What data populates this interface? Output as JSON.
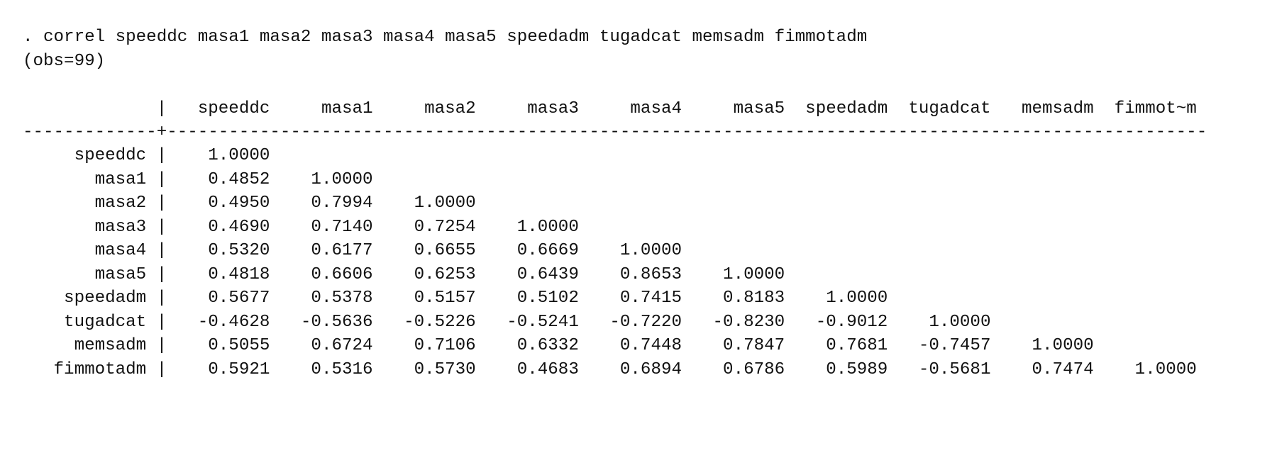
{
  "command": ". correl speeddc masa1 masa2 masa3 masa4 masa5 speedadm tugadcat memsadm fimmotadm",
  "obs_note": "(obs=99)",
  "column_headers": [
    "speeddc",
    "masa1",
    "masa2",
    "masa3",
    "masa4",
    "masa5",
    "speedadm",
    "tugadcat",
    "memsadm",
    "fimmot~m"
  ],
  "rows": [
    {
      "label": "speeddc",
      "values": [
        "1.0000"
      ]
    },
    {
      "label": "masa1",
      "values": [
        "0.4852",
        "1.0000"
      ]
    },
    {
      "label": "masa2",
      "values": [
        "0.4950",
        "0.7994",
        "1.0000"
      ]
    },
    {
      "label": "masa3",
      "values": [
        "0.4690",
        "0.7140",
        "0.7254",
        "1.0000"
      ]
    },
    {
      "label": "masa4",
      "values": [
        "0.5320",
        "0.6177",
        "0.6655",
        "0.6669",
        "1.0000"
      ]
    },
    {
      "label": "masa5",
      "values": [
        "0.4818",
        "0.6606",
        "0.6253",
        "0.6439",
        "0.8653",
        "1.0000"
      ]
    },
    {
      "label": "speedadm",
      "values": [
        "0.5677",
        "0.5378",
        "0.5157",
        "0.5102",
        "0.7415",
        "0.8183",
        "1.0000"
      ]
    },
    {
      "label": "tugadcat",
      "values": [
        "-0.4628",
        "-0.5636",
        "-0.5226",
        "-0.5241",
        "-0.7220",
        "-0.8230",
        "-0.9012",
        "1.0000"
      ]
    },
    {
      "label": "memsadm",
      "values": [
        "0.5055",
        "0.6724",
        "0.7106",
        "0.6332",
        "0.7448",
        "0.7847",
        "0.7681",
        "-0.7457",
        "1.0000"
      ]
    },
    {
      "label": "fimmotadm",
      "values": [
        "0.5921",
        "0.5316",
        "0.5730",
        "0.4683",
        "0.6894",
        "0.6786",
        "0.5989",
        "-0.5681",
        "0.7474",
        "1.0000"
      ]
    }
  ]
}
